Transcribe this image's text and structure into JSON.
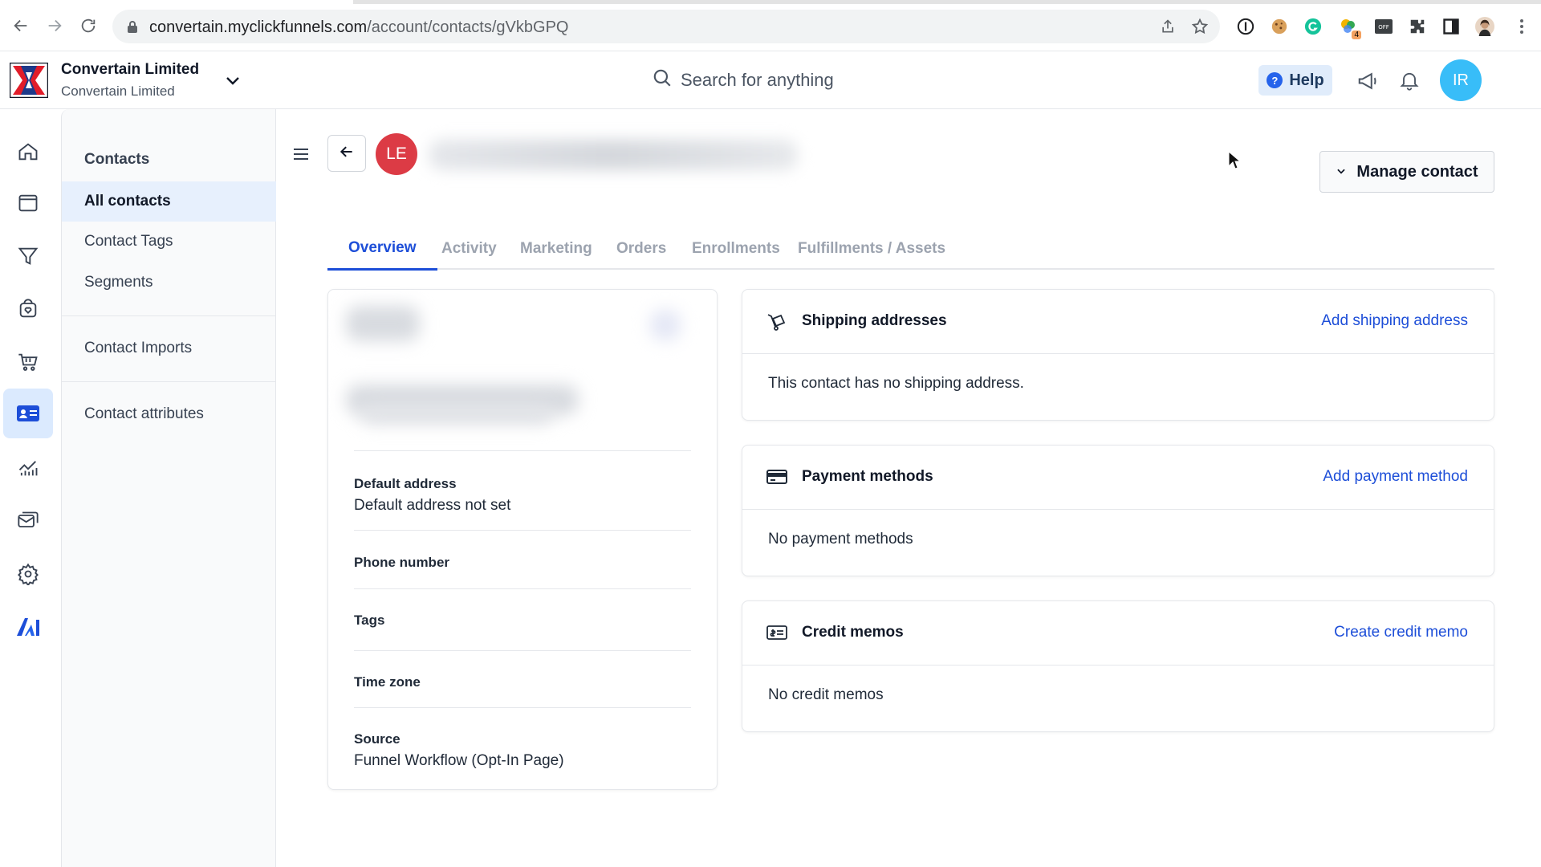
{
  "browser": {
    "url_domain": "convertain.myclickfunnels.com",
    "url_path": "/account/contacts/gVkbGPQ",
    "extension_badge": "4"
  },
  "header": {
    "org_name": "Convertain Limited",
    "org_subtitle": "Convertain Limited",
    "search_placeholder": "Search for anything",
    "help_label": "Help",
    "user_initials": "IR"
  },
  "rail": {
    "items": [
      "home-icon",
      "browser-window-icon",
      "funnel-icon",
      "store-icon",
      "cart-icon",
      "contact-card-icon",
      "analytics-icon",
      "mail-icon",
      "settings-icon",
      "ai-icon"
    ],
    "active": "contact-card-icon"
  },
  "subnav": {
    "title": "Contacts",
    "items": [
      {
        "label": "All contacts",
        "active": true
      },
      {
        "label": "Contact Tags"
      },
      {
        "label": "Segments"
      },
      {
        "label": "Contact Imports"
      },
      {
        "label": "Contact attributes"
      }
    ]
  },
  "contact": {
    "initials": "LE",
    "manage_label": "Manage contact"
  },
  "tabs": [
    "Overview",
    "Activity",
    "Marketing",
    "Orders",
    "Enrollments",
    "Fulfillments / Assets"
  ],
  "profile": {
    "fields": [
      {
        "label": "Default address",
        "value": "Default address not set"
      },
      {
        "label": "Phone number",
        "value": ""
      },
      {
        "label": "Tags",
        "value": ""
      },
      {
        "label": "Time zone",
        "value": ""
      },
      {
        "label": "Source",
        "value": "Funnel Workflow (Opt-In Page)"
      }
    ]
  },
  "panels": [
    {
      "title": "Shipping addresses",
      "action": "Add shipping address",
      "body": "This contact has no shipping address.",
      "icon": "shipping-cart-icon"
    },
    {
      "title": "Payment methods",
      "action": "Add payment method",
      "body": "No payment methods",
      "icon": "credit-card-icon"
    },
    {
      "title": "Credit memos",
      "action": "Create credit memo",
      "body": "No credit memos",
      "icon": "memo-icon"
    }
  ],
  "colors": {
    "accent": "#1d4ed8",
    "avatar_contact": "#dc3b45",
    "avatar_user": "#38bdf8",
    "active_nav": "#dbeafe"
  }
}
